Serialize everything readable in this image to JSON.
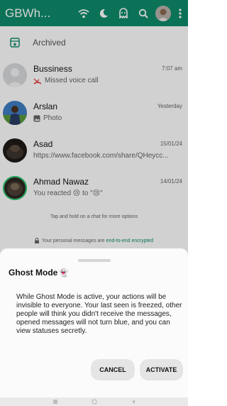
{
  "header": {
    "title": "GBWh...",
    "icons": [
      "wifi-icon",
      "moon-icon",
      "ghost-icon",
      "search-icon",
      "profile-avatar",
      "more-vert-icon"
    ],
    "color": "#0e8b6c"
  },
  "archived": {
    "label": "Archived",
    "icon": "archive-icon"
  },
  "chats": [
    {
      "name": "Bussiness",
      "time": "7:07 am",
      "message": "Missed voice call",
      "icon": "missed-call-icon"
    },
    {
      "name": "Arslan",
      "time": "Yesterday",
      "message": "Photo",
      "icon": "photo-icon"
    },
    {
      "name": "Asad",
      "time": "15/01/24",
      "message": "https://www.facebook.com/share/QHeycc..."
    },
    {
      "name": "Ahmad Nawaz",
      "time": "14/01/24",
      "message": "You reacted 😢 to \"😢\""
    }
  ],
  "hint": "Tap and hold on a chat for more options",
  "encryption": {
    "text": "Your personal messages are",
    "link": "end-to-end encrypted"
  },
  "sheet": {
    "title": "Ghost Mode",
    "title_emoji": "👻",
    "body": "While Ghost Mode is active, your actions will be invisible to everyone. Your last seen is freezed, other people will think you didn't receive the messages, opened messages will not turn blue, and you can view statuses secretly.",
    "cancel": "CANCEL",
    "activate": "ACTIVATE"
  }
}
